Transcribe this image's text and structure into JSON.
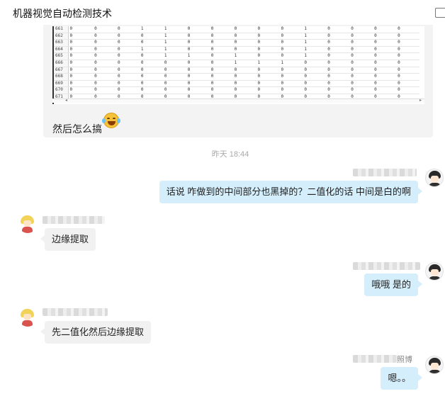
{
  "window": {
    "title": "机器视觉自动检测技术"
  },
  "sheet": {
    "rows": [
      {
        "id": "661",
        "cells": [
          "0",
          "0",
          "0",
          "1",
          "1",
          "0",
          "0",
          "0",
          "0",
          "0",
          "1",
          "0",
          "0",
          "0",
          "0"
        ]
      },
      {
        "id": "662",
        "cells": [
          "0",
          "0",
          "0",
          "0",
          "1",
          "0",
          "0",
          "0",
          "0",
          "0",
          "1",
          "0",
          "0",
          "0",
          "0"
        ]
      },
      {
        "id": "663",
        "cells": [
          "0",
          "0",
          "0",
          "0",
          "1",
          "0",
          "0",
          "0",
          "0",
          "0",
          "1",
          "0",
          "0",
          "0",
          "0"
        ]
      },
      {
        "id": "664",
        "cells": [
          "0",
          "0",
          "0",
          "1",
          "1",
          "0",
          "0",
          "0",
          "0",
          "0",
          "1",
          "0",
          "0",
          "0",
          "0"
        ]
      },
      {
        "id": "665",
        "cells": [
          "0",
          "0",
          "0",
          "0",
          "1",
          "1",
          "0",
          "1",
          "0",
          "0",
          "1",
          "0",
          "0",
          "0",
          "0"
        ]
      },
      {
        "id": "666",
        "cells": [
          "0",
          "0",
          "0",
          "0",
          "0",
          "0",
          "0",
          "1",
          "1",
          "1",
          "0",
          "0",
          "0",
          "0",
          "0"
        ]
      },
      {
        "id": "667",
        "cells": [
          "0",
          "0",
          "0",
          "0",
          "0",
          "0",
          "0",
          "0",
          "0",
          "0",
          "0",
          "0",
          "0",
          "0",
          "0"
        ]
      },
      {
        "id": "668",
        "cells": [
          "0",
          "0",
          "0",
          "0",
          "0",
          "0",
          "0",
          "0",
          "0",
          "0",
          "0",
          "0",
          "0",
          "0",
          "0"
        ]
      },
      {
        "id": "669",
        "cells": [
          "0",
          "0",
          "0",
          "0",
          "0",
          "0",
          "0",
          "0",
          "0",
          "0",
          "0",
          "0",
          "0",
          "0",
          "0"
        ]
      },
      {
        "id": "670",
        "cells": [
          "0",
          "0",
          "0",
          "0",
          "0",
          "0",
          "0",
          "0",
          "0",
          "0",
          "0",
          "0",
          "0",
          "0",
          "0"
        ]
      },
      {
        "id": "671",
        "cells": [
          "0",
          "0",
          "0",
          "0",
          "0",
          "0",
          "0",
          "0",
          "0",
          "0",
          "0",
          "0",
          "0",
          "0",
          "0"
        ]
      }
    ],
    "caption": "然后怎么搞",
    "emoji": "laughing-tears-emoji"
  },
  "time_separator": "昨天  18:44",
  "messages": [
    {
      "side": "me",
      "text": "话说 咋做到的中间部分也黑掉的？二值化的话  中间是白的啊"
    },
    {
      "side": "other",
      "text": "边缘提取"
    },
    {
      "side": "me",
      "text": "哦哦 是的"
    },
    {
      "side": "other",
      "text": "先二值化然后边缘提取"
    },
    {
      "side": "me",
      "text": "嗯。。",
      "name_tail": "照博"
    }
  ],
  "colors": {
    "me_bubble": "#d4eefb",
    "other_bubble": "#f1f1f1",
    "timestamp": "#aaaaaa"
  }
}
